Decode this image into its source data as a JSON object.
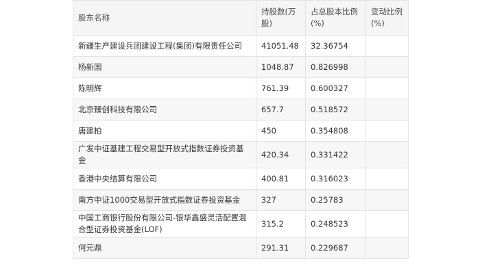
{
  "table": {
    "headers": {
      "name": "股东名称",
      "shares": "持股数(万股)",
      "ratio": "占总股本比例(%)",
      "change": "变动比例(%)"
    },
    "rows": [
      {
        "name": "新疆生产建设兵团建设工程(集团)有限责任公司",
        "shares": "41051.48",
        "ratio": "32.36754",
        "change": ""
      },
      {
        "name": "杨新国",
        "shares": "1048.87",
        "ratio": "0.826998",
        "change": ""
      },
      {
        "name": "陈明辉",
        "shares": "761.39",
        "ratio": "0.600327",
        "change": ""
      },
      {
        "name": "北京臻创科技有限公司",
        "shares": "657.7",
        "ratio": "0.518572",
        "change": ""
      },
      {
        "name": "唐建柏",
        "shares": "450",
        "ratio": "0.354808",
        "change": ""
      },
      {
        "name": "广发中证基建工程交易型开放式指数证券投资基金",
        "shares": "420.34",
        "ratio": "0.331422",
        "change": ""
      },
      {
        "name": "香港中央结算有限公司",
        "shares": "400.81",
        "ratio": "0.316023",
        "change": ""
      },
      {
        "name": "南方中证1000交易型开放式指数证券投资基金",
        "shares": "327",
        "ratio": "0.25783",
        "change": ""
      },
      {
        "name": "中国工商银行股份有限公司-银华鑫盛灵活配置混合型证券投资基金(LOF)",
        "shares": "315.2",
        "ratio": "0.248523",
        "change": ""
      },
      {
        "name": "何元鼎",
        "shares": "291.31",
        "ratio": "0.229687",
        "change": ""
      }
    ]
  }
}
